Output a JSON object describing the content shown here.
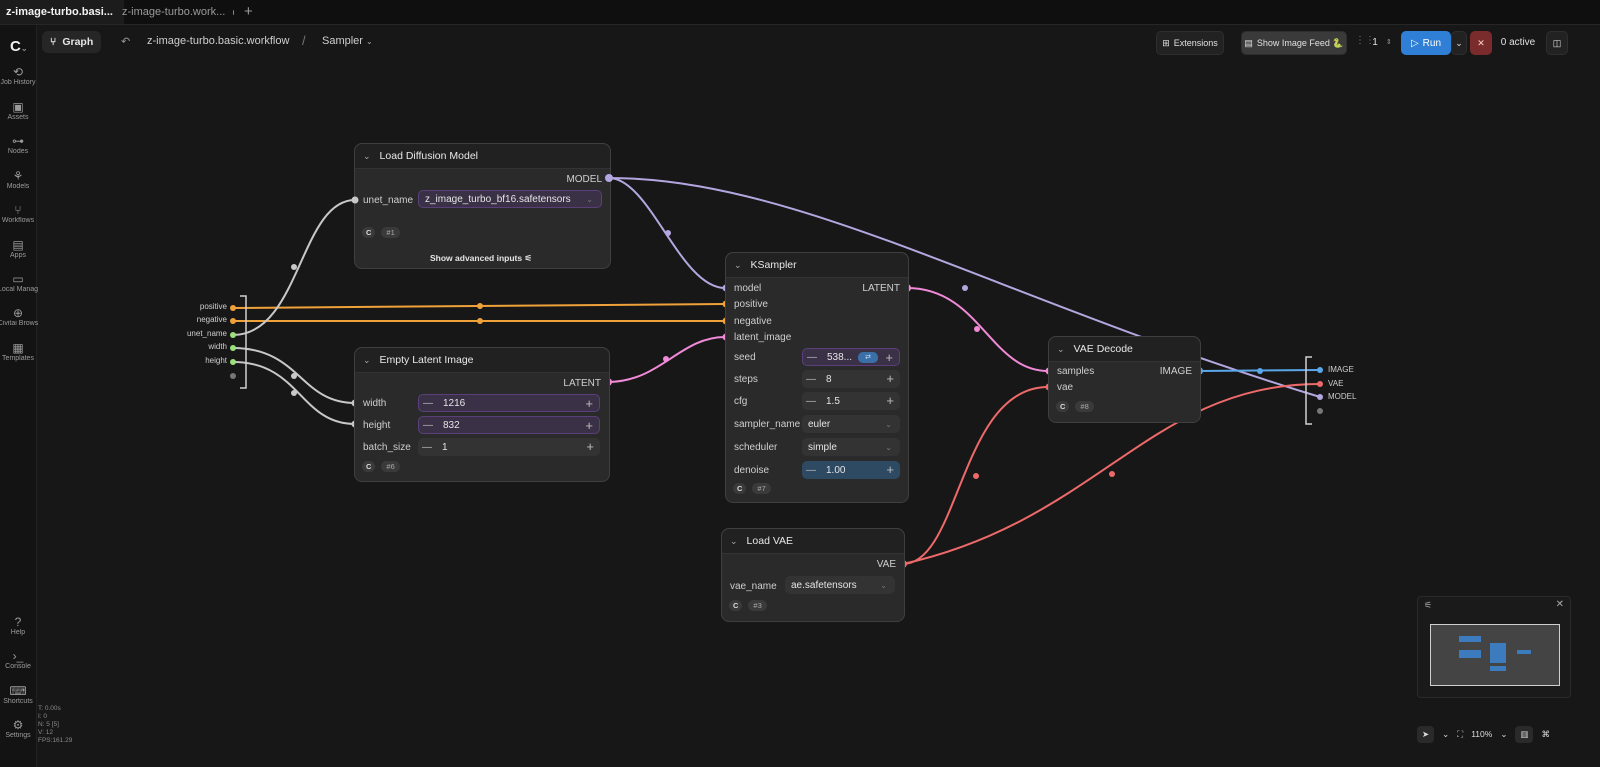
{
  "tabs": [
    {
      "label": "z-image-turbo.basi...",
      "active": true
    },
    {
      "label": "z-image-turbo.work...",
      "active": false
    }
  ],
  "sidebar": {
    "items": [
      {
        "label": "Job History",
        "icon": "history-icon",
        "glyph": "⟲"
      },
      {
        "label": "Assets",
        "icon": "image-icon",
        "glyph": "▣"
      },
      {
        "label": "Nodes",
        "icon": "nodes-icon",
        "glyph": "⊶"
      },
      {
        "label": "Models",
        "icon": "models-icon",
        "glyph": "⚘"
      },
      {
        "label": "Workflows",
        "icon": "workflow-icon",
        "glyph": "⑂"
      },
      {
        "label": "Apps",
        "icon": "apps-icon",
        "glyph": "▤"
      },
      {
        "label": "Local Manag",
        "icon": "folder-icon",
        "glyph": "▭"
      },
      {
        "label": "Civitai Brows",
        "icon": "globe-icon",
        "glyph": "⊕"
      },
      {
        "label": "Templates",
        "icon": "templates-icon",
        "glyph": "▦"
      }
    ],
    "bottom_items": [
      {
        "label": "Help",
        "icon": "help-icon",
        "glyph": "?"
      },
      {
        "label": "Console",
        "icon": "console-icon",
        "glyph": "›_"
      },
      {
        "label": "Shortcuts",
        "icon": "keyboard-icon",
        "glyph": "⌨"
      },
      {
        "label": "Settings",
        "icon": "gear-icon",
        "glyph": "⚙"
      }
    ],
    "stats": [
      "T: 0.00s",
      "I: 0",
      "N: 5 [5]",
      "V: 12",
      "FPS:161.29"
    ]
  },
  "toolbar": {
    "graph_label": "Graph",
    "workflow_name": "z-image-turbo.basic.workflow",
    "separator": "/",
    "subgraph": "Sampler",
    "extensions_label": "Extensions",
    "image_feed_label": "Show Image Feed 🐍",
    "batch_count": "1",
    "run_label": "Run",
    "active_label": "0 active"
  },
  "input_io": {
    "items": [
      "positive",
      "negative",
      "unet_name",
      "width",
      "height"
    ]
  },
  "output_io": {
    "items": [
      "IMAGE",
      "VAE",
      "MODEL"
    ]
  },
  "nodes": {
    "load_diffusion": {
      "title": "Load Diffusion Model",
      "output": "MODEL",
      "input": "unet_name",
      "value": "z_image_turbo_bf16.safetensors",
      "id": "#1",
      "advanced": "Show advanced inputs"
    },
    "empty_latent": {
      "title": "Empty Latent Image",
      "output": "LATENT",
      "width_label": "width",
      "width_value": "1216",
      "height_label": "height",
      "height_value": "832",
      "batch_label": "batch_size",
      "batch_value": "1",
      "id": "#6"
    },
    "ksampler": {
      "title": "KSampler",
      "inputs": [
        "model",
        "positive",
        "negative",
        "latent_image"
      ],
      "output": "LATENT",
      "seed_label": "seed",
      "seed_value": "538...",
      "steps_label": "steps",
      "steps_value": "8",
      "cfg_label": "cfg",
      "cfg_value": "1.5",
      "sampler_label": "sampler_name",
      "sampler_value": "euler",
      "scheduler_label": "scheduler",
      "scheduler_value": "simple",
      "denoise_label": "denoise",
      "denoise_value": "1.00",
      "id": "#7"
    },
    "vae_decode": {
      "title": "VAE Decode",
      "inputs": [
        "samples",
        "vae"
      ],
      "output": "IMAGE",
      "id": "#8"
    },
    "load_vae": {
      "title": "Load VAE",
      "output": "VAE",
      "input": "vae_name",
      "value": "ae.safetensors",
      "id": "#3"
    }
  },
  "zoom": "110%",
  "colors": {
    "model": "#b4a7e0",
    "conditioning": "#f0a23a",
    "latent": "#f08ad8",
    "vae": "#ee6a6a",
    "image": "#5aa7ea",
    "int": "#9be07a",
    "string": "#c8c8c8"
  }
}
